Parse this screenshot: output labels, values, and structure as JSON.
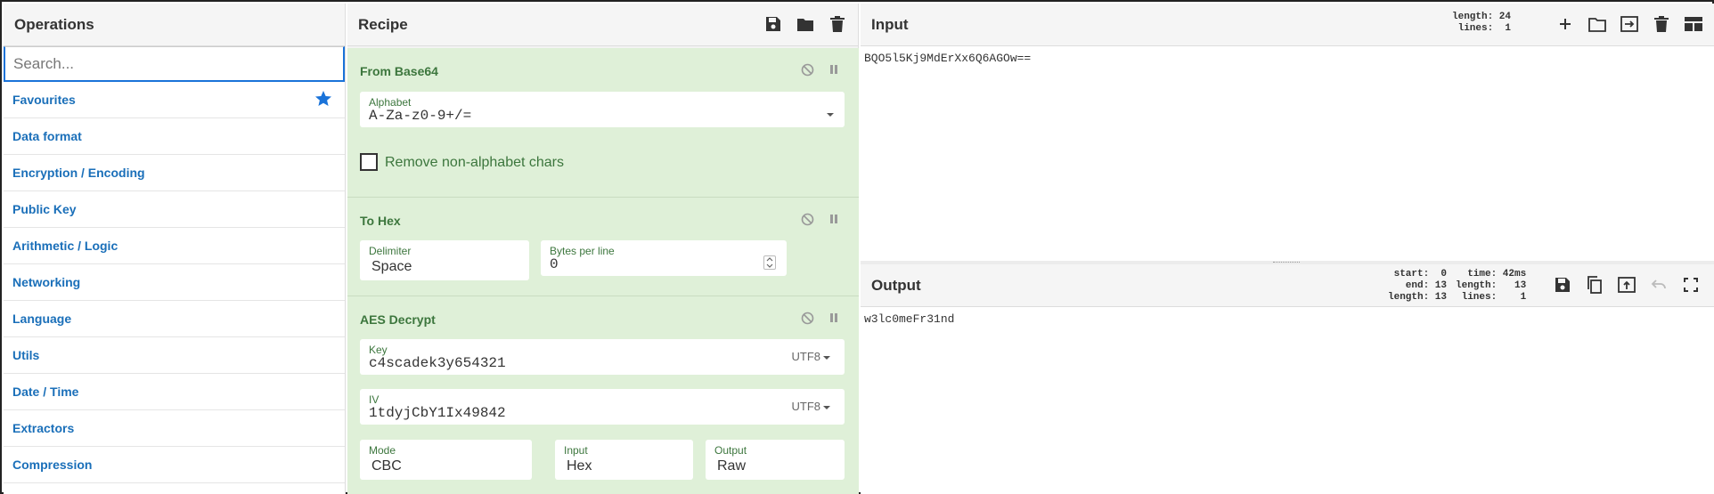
{
  "operations": {
    "title": "Operations",
    "search_placeholder": "Search...",
    "categories": [
      "Favourites",
      "Data format",
      "Encryption / Encoding",
      "Public Key",
      "Arithmetic / Logic",
      "Networking",
      "Language",
      "Utils",
      "Date / Time",
      "Extractors",
      "Compression"
    ]
  },
  "recipe": {
    "title": "Recipe",
    "icons": [
      "save-icon",
      "folder-icon",
      "trash-icon"
    ],
    "from_base64": {
      "title": "From Base64",
      "alphabet_label": "Alphabet",
      "alphabet_value": "A-Za-z0-9+/=",
      "remove_label": "Remove non-alphabet chars"
    },
    "to_hex": {
      "title": "To Hex",
      "delimiter_label": "Delimiter",
      "delimiter_value": "Space",
      "bytes_label": "Bytes per line",
      "bytes_value": "0"
    },
    "aes": {
      "title": "AES Decrypt",
      "key_label": "Key",
      "key_value": "c4scadek3y654321",
      "key_enc": "UTF8",
      "iv_label": "IV",
      "iv_value": "1tdyjCbY1Ix49842",
      "iv_enc": "UTF8",
      "mode_label": "Mode",
      "mode_value": "CBC",
      "input_label": "Input",
      "input_value": "Hex",
      "output_label": "Output",
      "output_value": "Raw"
    }
  },
  "input": {
    "title": "Input",
    "stats": "length: 24\n lines:  1",
    "text": "BQO5l5Kj9MdErXx6Q6AGOw=="
  },
  "output": {
    "title": "Output",
    "stats_left": "start:  0\n  end: 13\nlength: 13",
    "stats_right": "  time: 42ms\nlength:   13\n lines:    1",
    "text": "w3lc0meFr31nd"
  },
  "colors": {
    "accent": "#1a73d9",
    "op_bg": "#dff0d8",
    "op_text": "#3c763d",
    "category": "#1a6fb9"
  }
}
